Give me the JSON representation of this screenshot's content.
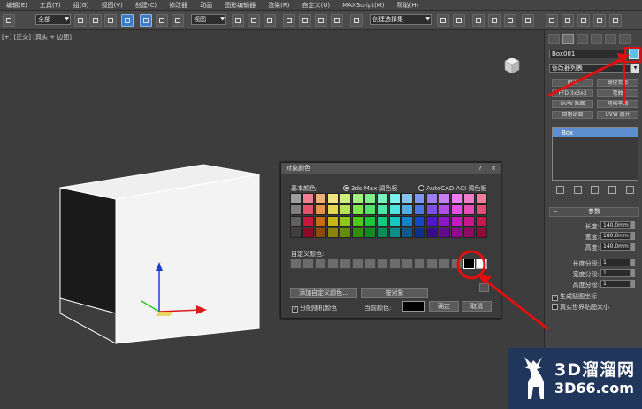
{
  "menu": [
    "编辑(E)",
    "工具(T)",
    "组(G)",
    "视图(V)",
    "创建(C)",
    "修改器",
    "动画",
    "图形编辑器",
    "渲染(R)",
    "自定义(U)",
    "MAXScript(M)",
    "帮助(H)"
  ],
  "toolbar": {
    "selection_filter": "全部",
    "reference_coord": "视图",
    "named_selection": "创建选择集"
  },
  "viewport": {
    "label": "[+] [正交] [真实 + 边面]"
  },
  "command_panel": {
    "object_name": "Box001",
    "object_color": "#5ec0e8",
    "modifier_list": "修改器列表",
    "modifier_buttons": [
      "挤出",
      "路径变形",
      "FFD 3x3x3",
      "弯曲",
      "UVW 贴图",
      "网格平滑",
      "倒角剖面",
      "UVW 展开"
    ],
    "stack_item": "Box",
    "params_title": "参数",
    "params": [
      {
        "label": "长度:",
        "value": "140.0mm"
      },
      {
        "label": "宽度:",
        "value": "180.0mm"
      },
      {
        "label": "高度:",
        "value": "140.0mm"
      },
      {
        "label": "长度分段:",
        "value": "1"
      },
      {
        "label": "宽度分段:",
        "value": "1"
      },
      {
        "label": "高度分段:",
        "value": "1"
      }
    ],
    "checkboxes": [
      {
        "label": "生成贴图坐标",
        "checked": true
      },
      {
        "label": "真实世界贴图大小",
        "checked": false
      }
    ]
  },
  "dialog": {
    "title": "对象颜色",
    "help": "?",
    "close": "×",
    "basic_colors_label": "基本颜色:",
    "radio_max": "3ds Max 调色板",
    "radio_acad": "AutoCAD ACI 调色板",
    "custom_colors_label": "自定义颜色:",
    "add_custom_button": "添加自定义颜色...",
    "by_object_button": "按对象",
    "random_color_checkbox": "分配随机颜色",
    "current_color_label": "当前颜色:",
    "current_color": "#000000",
    "ok_button": "确定",
    "cancel_button": "取消",
    "palette": [
      "#9e9e9e",
      "#f07e92",
      "#f0b07e",
      "#f0e47e",
      "#cff07e",
      "#a2f07e",
      "#7ef08a",
      "#7ef0bd",
      "#7ef0ee",
      "#7ec6f0",
      "#7e97f0",
      "#9c7ef0",
      "#c67ef0",
      "#ef7ef0",
      "#f07ec7",
      "#f07e9a",
      "#7f7f7f",
      "#e5506b",
      "#e5934f",
      "#e5d74f",
      "#b7e54f",
      "#7ee54f",
      "#4fe568",
      "#4fe5a8",
      "#4fe5e2",
      "#4faee5",
      "#4f75e5",
      "#7f4fe5",
      "#b14fe5",
      "#e54fe3",
      "#e54fb3",
      "#e54f77",
      "#5f5f5f",
      "#c8173c",
      "#c86b17",
      "#c8b817",
      "#8fc817",
      "#4fc817",
      "#17c83a",
      "#17c882",
      "#17c8c2",
      "#1782c8",
      "#1747c8",
      "#5217c8",
      "#8b17c8",
      "#c817c4",
      "#c8178b",
      "#c8174e",
      "#3f3f3f",
      "#8d0b26",
      "#8d4a0b",
      "#8d820b",
      "#638d0b",
      "#328d0b",
      "#0b8d24",
      "#0b8d5a",
      "#0b8d89",
      "#0b5a8d",
      "#0b2f8d",
      "#360b8d",
      "#610b8d",
      "#8d0b8a",
      "#8d0b61",
      "#8d0b34"
    ]
  },
  "logo": {
    "title": "3D溜溜网",
    "url": "3D66.com"
  }
}
